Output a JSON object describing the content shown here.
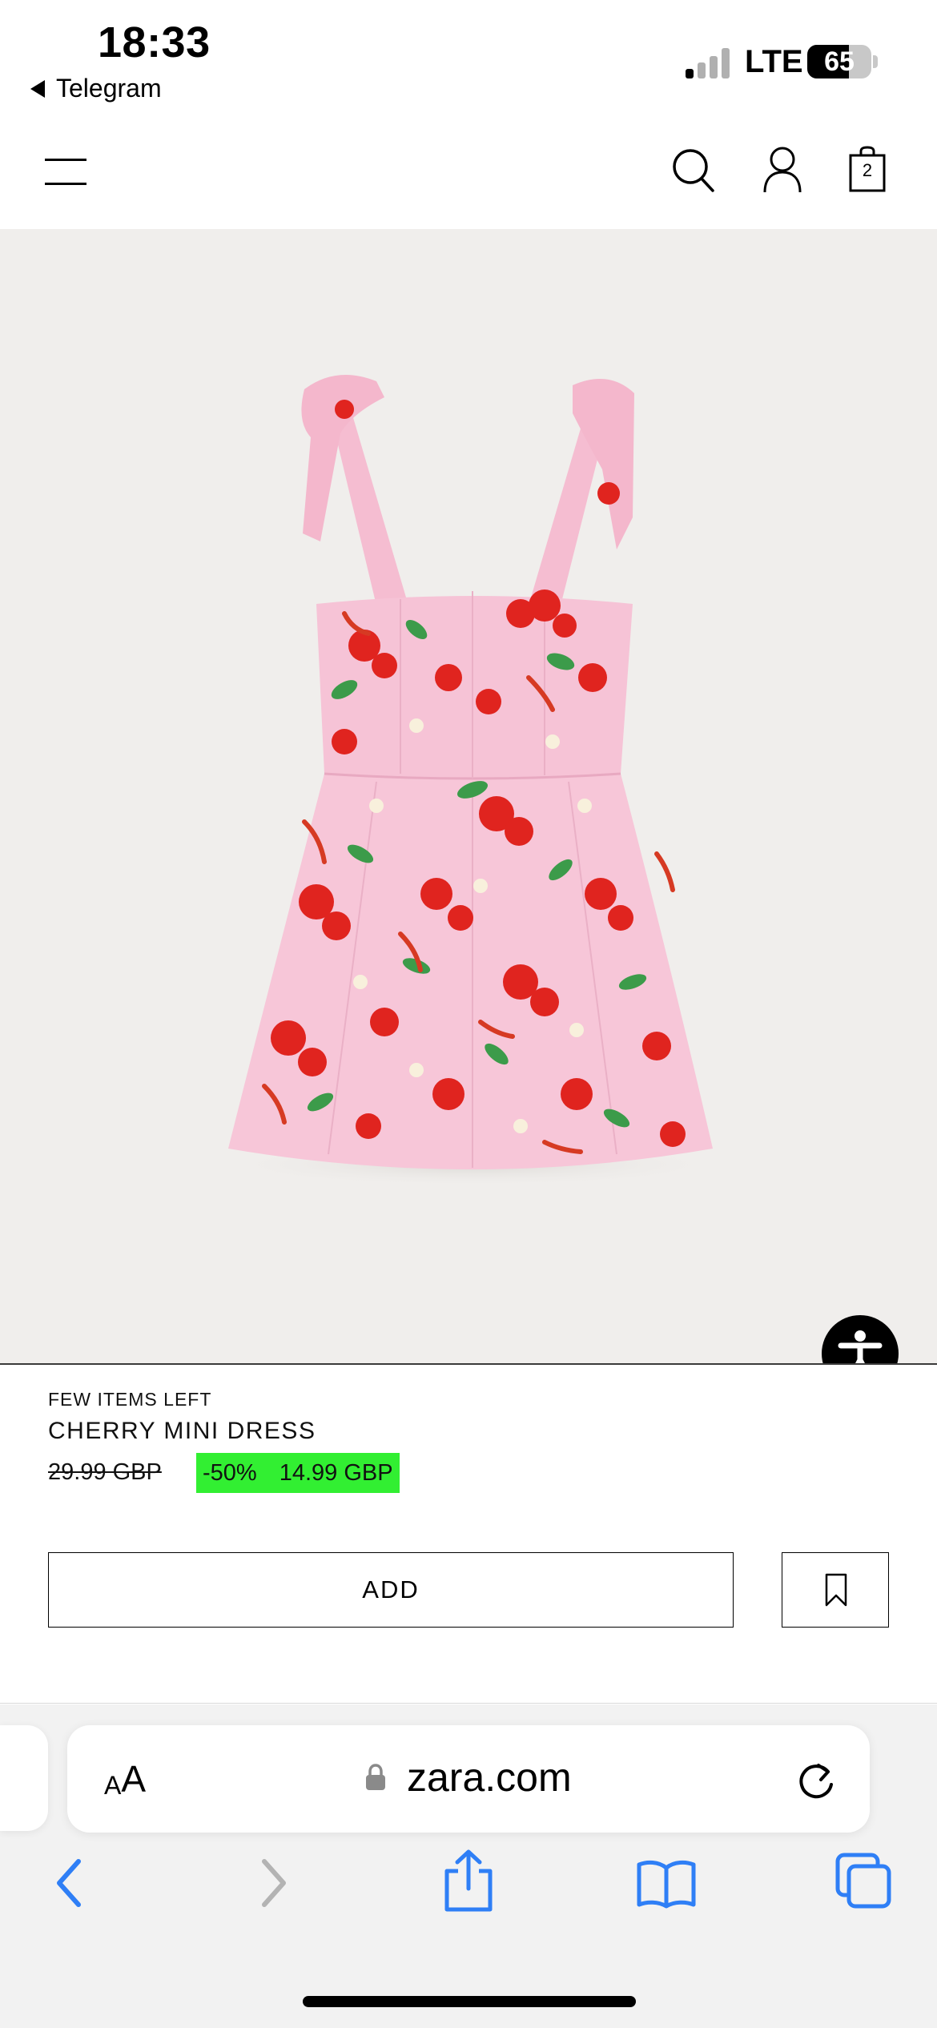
{
  "status_bar": {
    "time": "18:33",
    "back_app": "Telegram",
    "network": "LTE",
    "battery_percent": 65,
    "battery_label": "65"
  },
  "header": {
    "cart_count": "2",
    "icons": [
      "menu-icon",
      "search-icon",
      "account-icon",
      "shopping-bag-icon"
    ]
  },
  "product": {
    "stock_label": "FEW ITEMS LEFT",
    "name": "CHERRY MINI DRESS",
    "original_price": "29.99 GBP",
    "discount": "-50%",
    "sale_price": "14.99 GBP",
    "add_label": "ADD",
    "sale_highlight_color": "#32ef32"
  },
  "browser": {
    "text_size_small": "A",
    "text_size_large": "A",
    "url": "zara.com",
    "accent_color": "#2f7ff6",
    "toolbar_icons": [
      "back-icon",
      "forward-icon",
      "share-icon",
      "bookmarks-icon",
      "tabs-icon"
    ]
  }
}
